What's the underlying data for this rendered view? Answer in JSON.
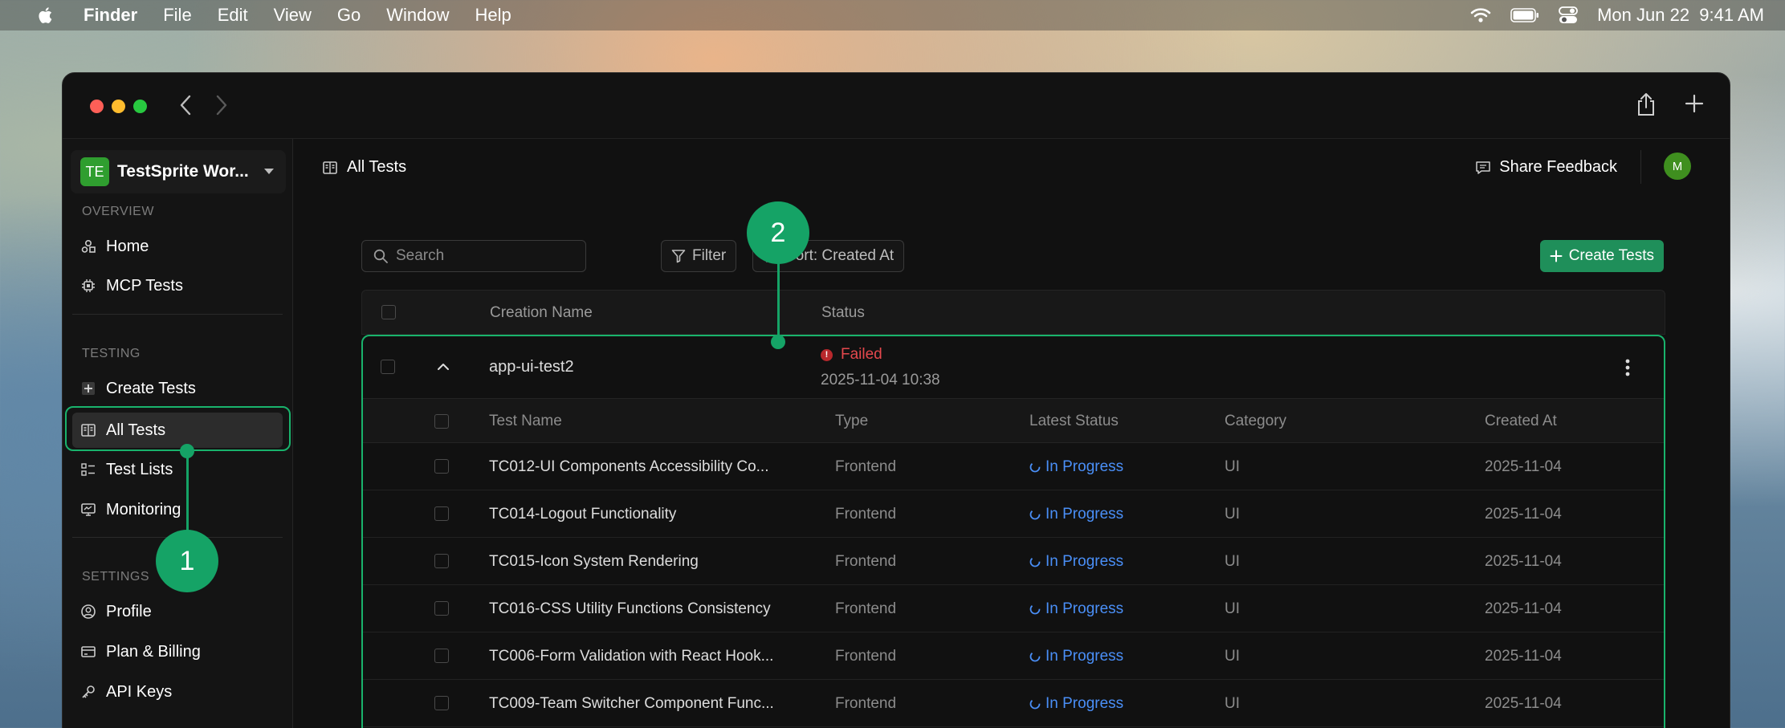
{
  "menubar": {
    "app": "Finder",
    "items": [
      "File",
      "Edit",
      "View",
      "Go",
      "Window",
      "Help"
    ],
    "datetime": "Mon Jun 22  9:41 AM"
  },
  "sidebar": {
    "workspace_initials": "TE",
    "workspace_name": "TestSprite Wor...",
    "overview_label": "OVERVIEW",
    "testing_label": "TESTING",
    "settings_label": "SETTINGS",
    "items": {
      "home": "Home",
      "mcp": "MCP Tests",
      "create": "Create Tests",
      "all": "All Tests",
      "lists": "Test Lists",
      "monitoring": "Monitoring",
      "profile": "Profile",
      "billing": "Plan & Billing",
      "keys": "API Keys"
    }
  },
  "header": {
    "breadcrumb": "All Tests",
    "feedback": "Share Feedback",
    "avatar": "M"
  },
  "toolbar": {
    "search_placeholder": "Search",
    "filter": "Filter",
    "sort": "Sort: Created At",
    "create": "Create Tests"
  },
  "table": {
    "col_name": "Creation Name",
    "col_status": "Status",
    "group": {
      "name": "app-ui-test2",
      "status": "Failed",
      "date": "2025-11-04 10:38"
    },
    "sub_headers": {
      "name": "Test Name",
      "type": "Type",
      "latest": "Latest Status",
      "category": "Category",
      "created": "Created At"
    },
    "rows": [
      {
        "name": "TC012-UI Components Accessibility Co...",
        "type": "Frontend",
        "status": "In Progress",
        "category": "UI",
        "created": "2025-11-04"
      },
      {
        "name": "TC014-Logout Functionality",
        "type": "Frontend",
        "status": "In Progress",
        "category": "UI",
        "created": "2025-11-04"
      },
      {
        "name": "TC015-Icon System Rendering",
        "type": "Frontend",
        "status": "In Progress",
        "category": "UI",
        "created": "2025-11-04"
      },
      {
        "name": "TC016-CSS Utility Functions Consistency",
        "type": "Frontend",
        "status": "In Progress",
        "category": "UI",
        "created": "2025-11-04"
      },
      {
        "name": "TC006-Form Validation with React Hook...",
        "type": "Frontend",
        "status": "In Progress",
        "category": "UI",
        "created": "2025-11-04"
      },
      {
        "name": "TC009-Team Switcher Component Func...",
        "type": "Frontend",
        "status": "In Progress",
        "category": "UI",
        "created": "2025-11-04"
      }
    ]
  },
  "callouts": [
    "1",
    "2"
  ],
  "colors": {
    "accent": "#15a366",
    "in_progress": "#4a8ff7",
    "failed": "#e5484d"
  }
}
